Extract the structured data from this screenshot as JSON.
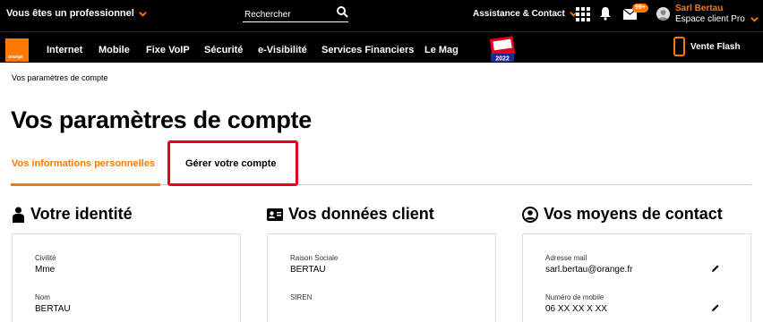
{
  "topbar": {
    "pro_select": "Vous êtes un professionnel",
    "search_placeholder": "Rechercher",
    "assistance": "Assistance & Contact",
    "notification_badge": "99+",
    "user_name": "Sarl Bertau",
    "user_space": "Espace client Pro"
  },
  "nav": {
    "logo_text": "orange",
    "items": [
      "Internet",
      "Mobile",
      "Fixe VoIP",
      "Sécurité",
      "e-Visibilité",
      "Services Financiers",
      "Le Mag"
    ],
    "award_text": "2022",
    "vente_flash": "Vente Flash"
  },
  "breadcrumb": "Vos paramètres de compte",
  "page_title": "Vos paramètres de compte",
  "tabs": {
    "info": "Vos informations personnelles",
    "manage": "Gérer votre compte"
  },
  "identity": {
    "title": "Votre identité",
    "civility_label": "Civilité",
    "civility_value": "Mme",
    "name_label": "Nom",
    "name_value": "BERTAU"
  },
  "client": {
    "title": "Vos données client",
    "company_label": "Raison Sociale",
    "company_value": "BERTAU",
    "siren_label": "SIREN"
  },
  "contact": {
    "title": "Vos moyens de contact",
    "email_label": "Adresse mail",
    "email_value": "sarl.bertau@orange.fr",
    "mobile_label": "Numéro de mobile",
    "mobile_value": "06 XX XX X XX"
  },
  "colors": {
    "brand": "#ff7900",
    "highlight": "#e3001b"
  }
}
